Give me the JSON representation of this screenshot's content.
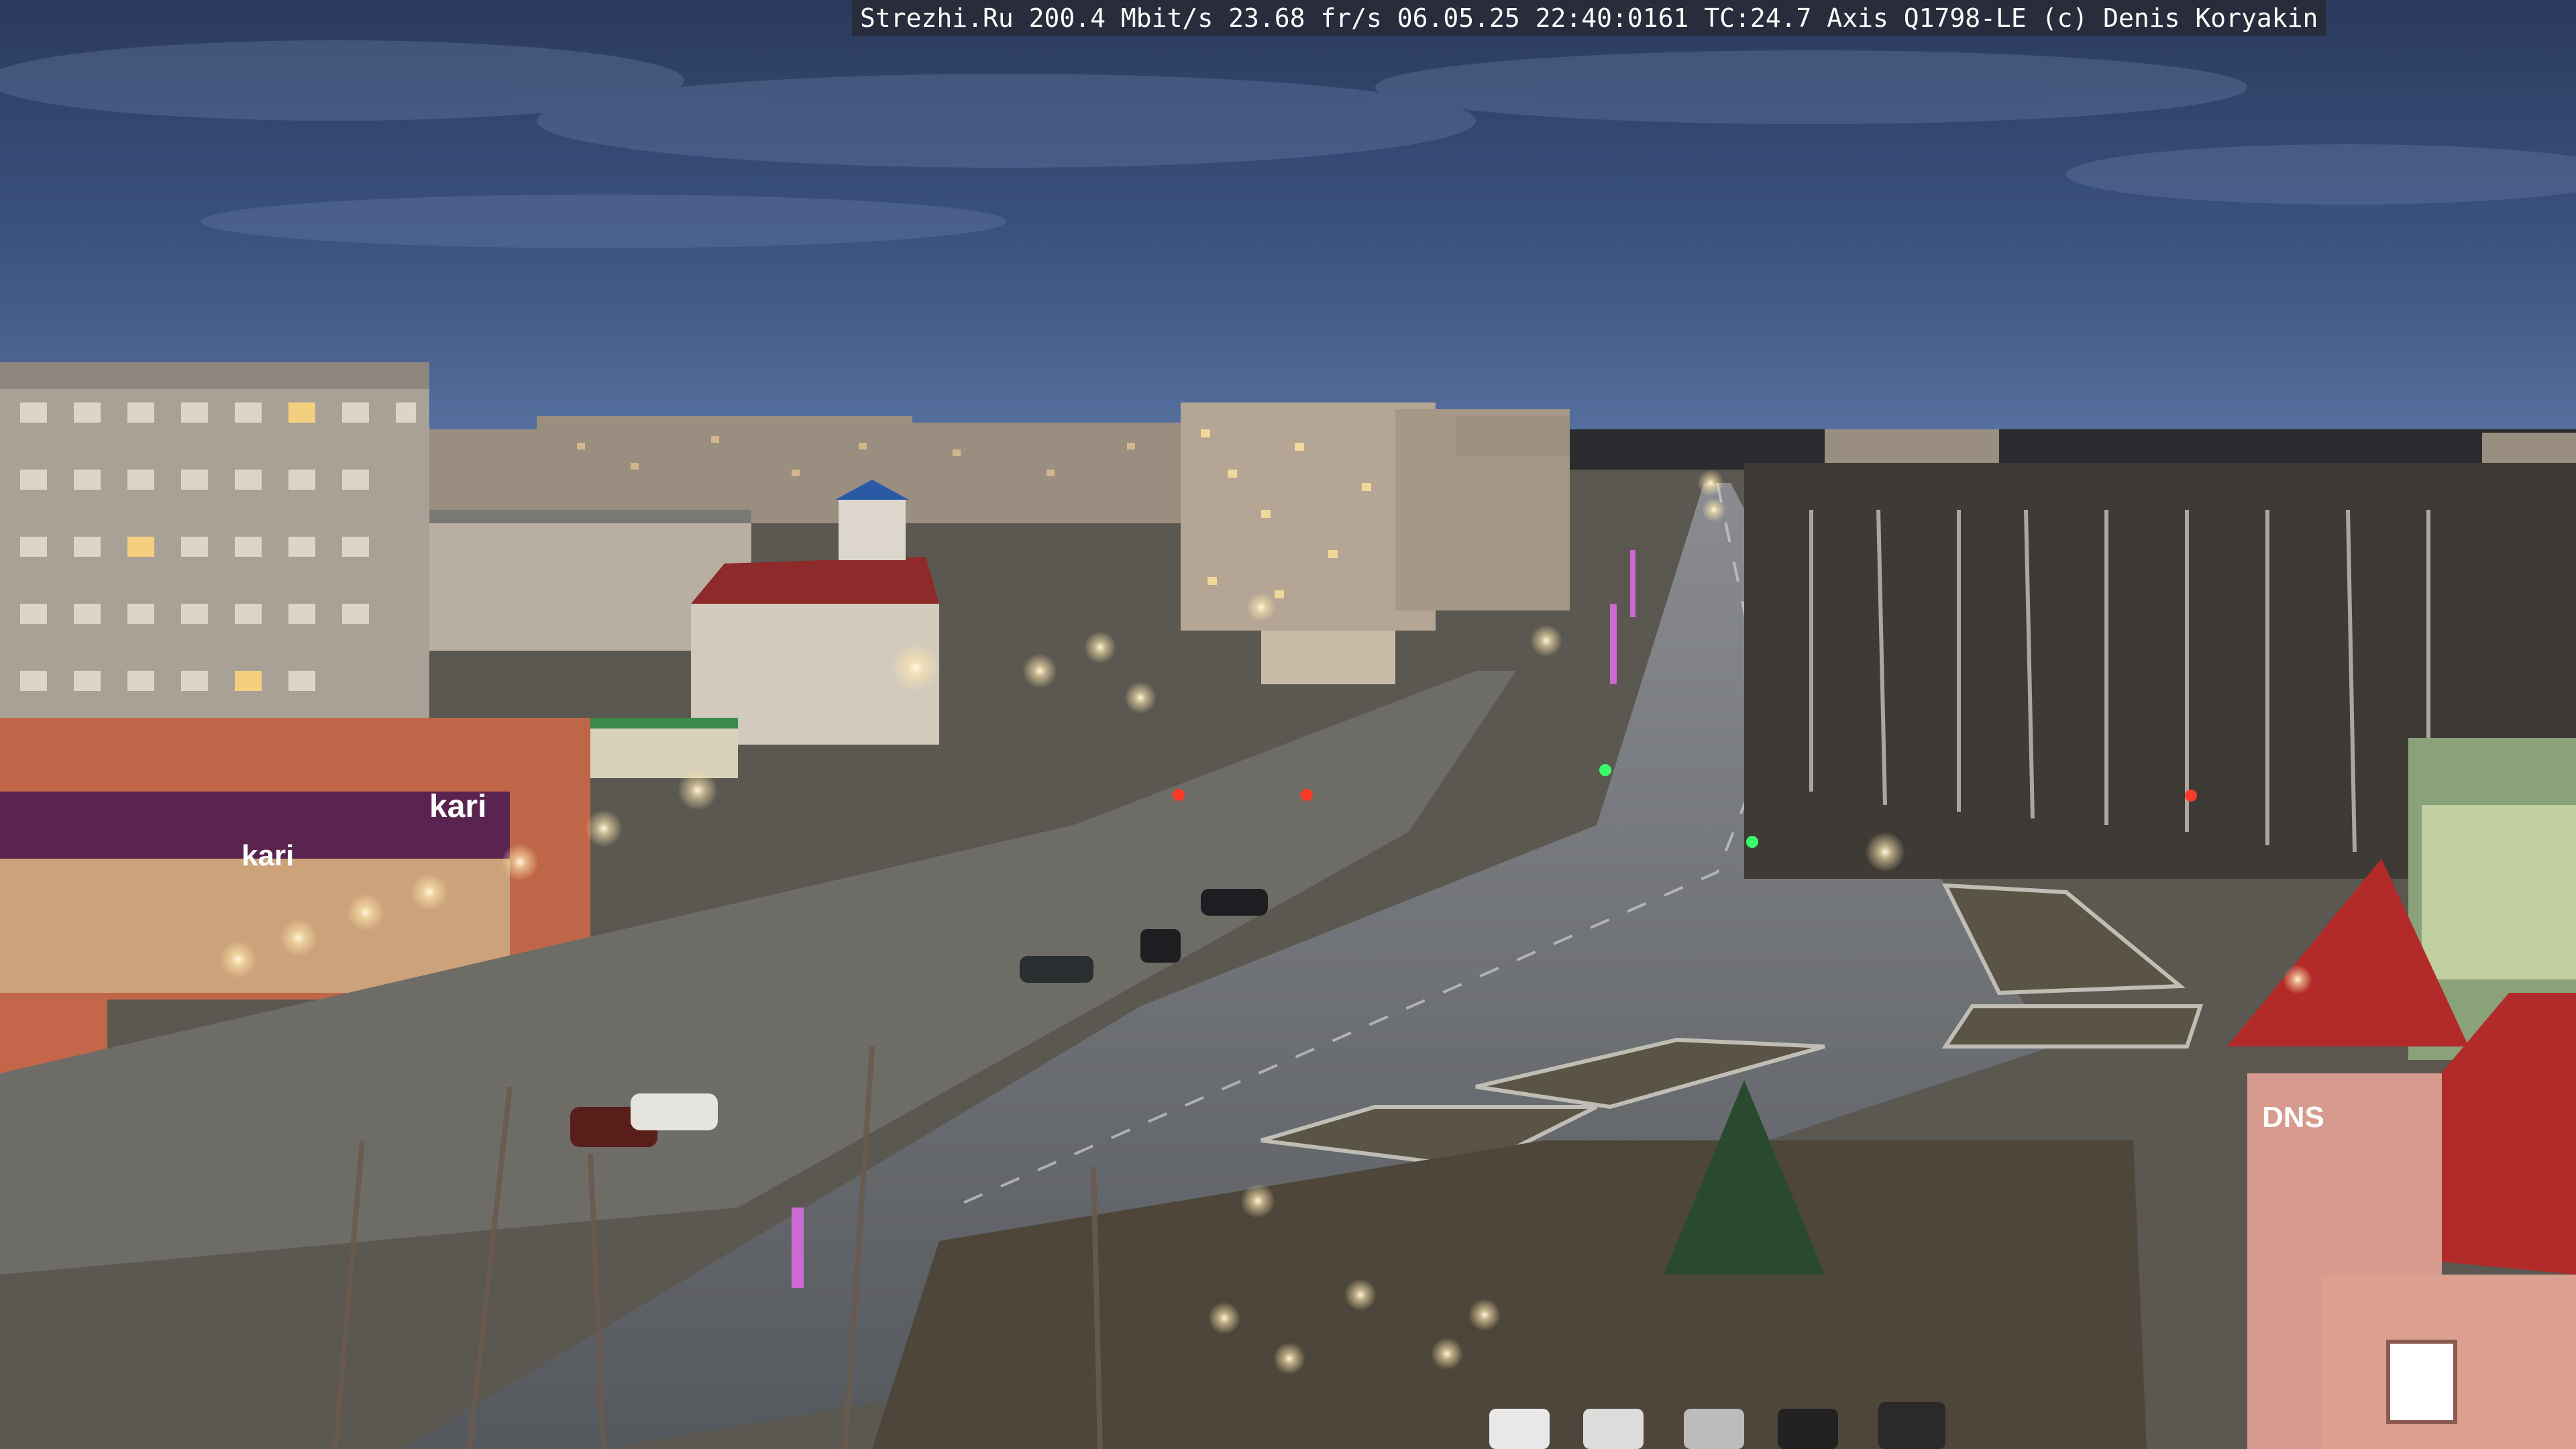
{
  "camera_overlay": {
    "text": "Strezhi.Ru 200.4 Mbit/s 23.68 fr/s 06.05.25 22:40:0161 TC:24.7  Axis Q1798-LE  (c) Denis Koryakin"
  },
  "signage": {
    "store_left_1": "kari",
    "store_left_2": "kari",
    "store_right": "DNS"
  },
  "colors": {
    "sky_top": "#2a3a5c",
    "sky_bottom": "#4a6a9a",
    "road": "#6a6c6e",
    "plaza": "#7a7a76",
    "roof_red": "#b0202a",
    "building_wall": "#b8b0a4",
    "streetlight": "#fff4d8",
    "sign_purple": "#6a2a6a"
  }
}
